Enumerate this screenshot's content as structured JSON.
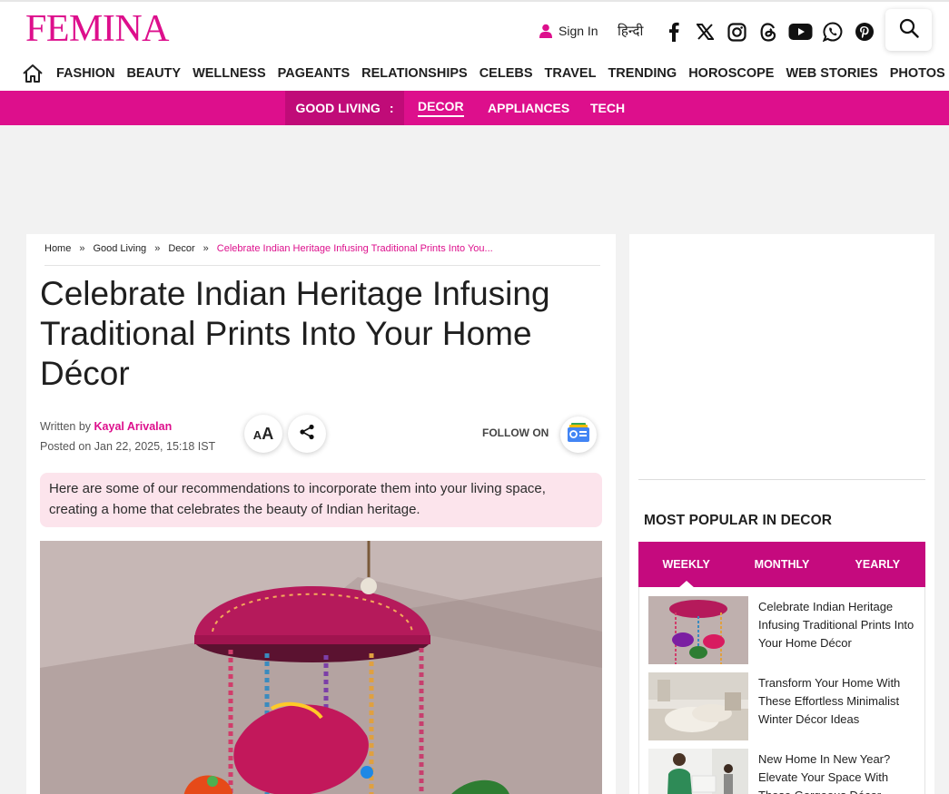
{
  "header": {
    "logo": "FEMINA",
    "sign_in": "Sign In",
    "hindi": "हिन्दी",
    "social_icons": [
      "facebook-icon",
      "x-icon",
      "instagram-icon",
      "threads-icon",
      "youtube-icon",
      "whatsapp-icon",
      "pinterest-icon"
    ],
    "brand_color": "#dd0f8c"
  },
  "nav": {
    "items": [
      "FASHION",
      "BEAUTY",
      "WELLNESS",
      "PAGEANTS",
      "RELATIONSHIPS",
      "CELEBS",
      "TRAVEL",
      "TRENDING",
      "HOROSCOPE",
      "WEB STORIES",
      "PHOTOS"
    ]
  },
  "subnav": {
    "main": "GOOD LIVING",
    "main_marker": ":",
    "items": [
      "DECOR",
      "APPLIANCES",
      "TECH"
    ],
    "active": "DECOR"
  },
  "breadcrumb": {
    "items": [
      "Home",
      "Good Living",
      "Decor"
    ],
    "separator": "»",
    "current": "Celebrate Indian Heritage Infusing Traditional Prints Into You..."
  },
  "article": {
    "title": "Celebrate Indian Heritage Infusing Traditional Prints Into Your Home Décor",
    "written_by_label": "Written by",
    "author": "Kayal Arivalan",
    "posted": "Posted on Jan 22, 2025, 15:18 IST",
    "font_size_small": "A",
    "font_size_large": "A",
    "follow_on": "FOLLOW ON",
    "summary": "Here are some of our recommendations to incorporate them into your living space, creating a home that celebrates the beauty of Indian heritage."
  },
  "sidebar": {
    "most_popular_title": "MOST POPULAR IN DECOR",
    "tabs": [
      "WEEKLY",
      "MONTHLY",
      "YEARLY"
    ],
    "active_tab": "WEEKLY",
    "popular": [
      {
        "title": "Celebrate Indian Heritage Infusing Traditional Prints Into Your Home Décor"
      },
      {
        "title": "Transform Your Home With These Effortless Minimalist Winter Décor Ideas"
      },
      {
        "title": "New Home In New Year? Elevate Your Space With These Gorgeous Décor"
      }
    ]
  }
}
